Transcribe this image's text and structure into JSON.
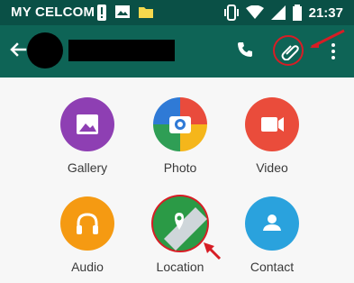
{
  "status": {
    "carrier": "MY CELCOM",
    "time": "21:37"
  },
  "header": {
    "name_redacted": true
  },
  "options": [
    {
      "id": "gallery",
      "label": "Gallery",
      "color": "#8e3fb3"
    },
    {
      "id": "photo",
      "label": "Photo",
      "color": "#f05a2a"
    },
    {
      "id": "video",
      "label": "Video",
      "color": "#ea4c3b"
    },
    {
      "id": "audio",
      "label": "Audio",
      "color": "#f59a12"
    },
    {
      "id": "location",
      "label": "Location",
      "color": "#2b9a46"
    },
    {
      "id": "contact",
      "label": "Contact",
      "color": "#2aa2dd"
    }
  ]
}
